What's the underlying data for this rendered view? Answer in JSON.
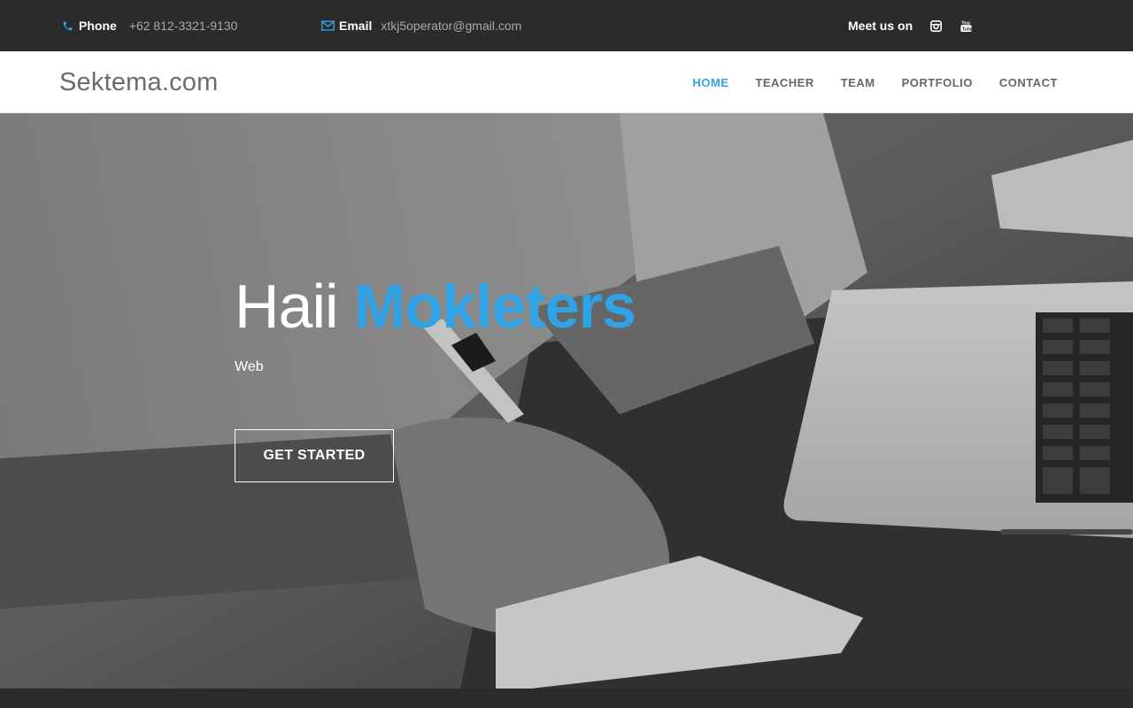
{
  "topbar": {
    "phone_label": "Phone",
    "phone_value": "+62 812-3321-9130",
    "email_label": "Email",
    "email_value": "xtkj5operator@gmail.com",
    "meet_label": "Meet us on",
    "icons": [
      "phone-icon",
      "envelope-icon",
      "instagram-icon",
      "youtube-icon"
    ],
    "accent_color": "#2fa3e6"
  },
  "nav": {
    "brand": "Sektema.com",
    "items": [
      {
        "label": "HOME",
        "active": true
      },
      {
        "label": "TEACHER",
        "active": false
      },
      {
        "label": "TEAM",
        "active": false
      },
      {
        "label": "PORTFOLIO",
        "active": false
      },
      {
        "label": "CONTACT",
        "active": false
      }
    ]
  },
  "hero": {
    "title_prefix": "Haii",
    "title_accent": "Mokleters",
    "subtitle": "Web",
    "cta_label": "GET STARTED"
  }
}
